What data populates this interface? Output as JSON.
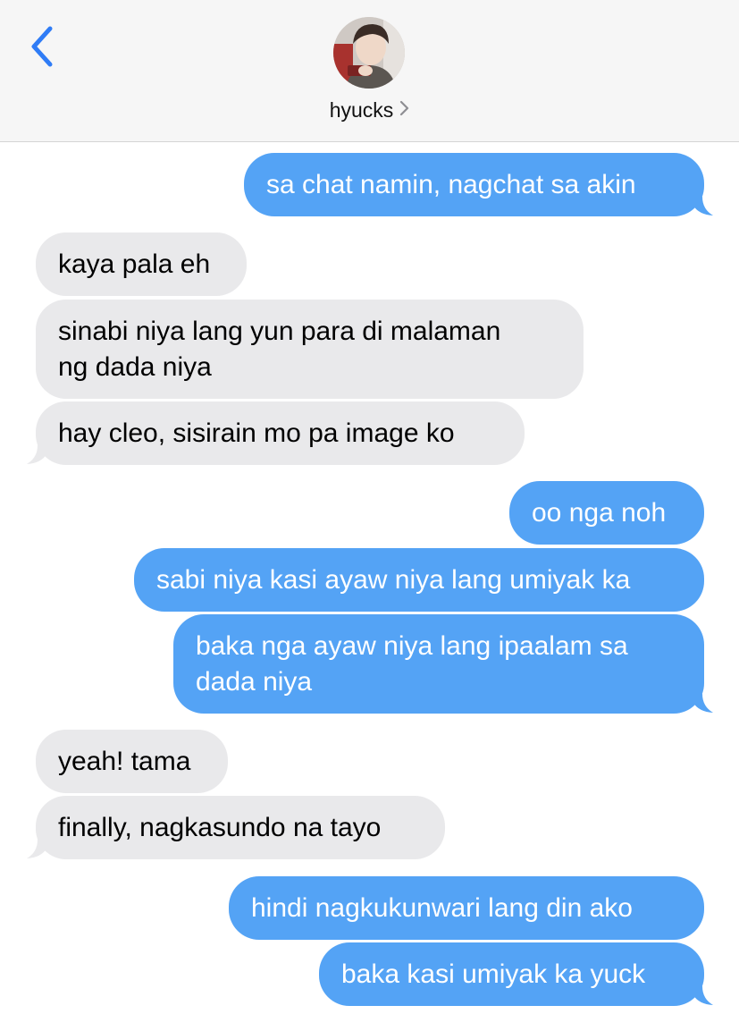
{
  "header": {
    "contact_name": "hyucks",
    "back_icon": "chevron-left-icon",
    "name_chevron_icon": "chevron-right-icon",
    "accent_color": "#2f7cf6"
  },
  "colors": {
    "incoming_bubble": "#e9e9eb",
    "outgoing_bubble": "#54a3f5",
    "header_background": "#f6f6f6"
  },
  "messages": [
    {
      "direction": "outgoing",
      "text": "sa chat namin, nagchat sa akin"
    },
    {
      "direction": "incoming",
      "text": "kaya pala eh"
    },
    {
      "direction": "incoming",
      "lines": [
        "sinabi niya lang yun para di malaman",
        "ng dada niya"
      ]
    },
    {
      "direction": "incoming",
      "text": "hay cleo, sisirain mo pa image ko"
    },
    {
      "direction": "outgoing",
      "text": "oo nga noh"
    },
    {
      "direction": "outgoing",
      "text": "sabi niya kasi ayaw niya lang umiyak ka"
    },
    {
      "direction": "outgoing",
      "lines": [
        "baka nga ayaw niya lang ipaalam sa",
        "dada niya"
      ]
    },
    {
      "direction": "incoming",
      "text": "yeah! tama"
    },
    {
      "direction": "incoming",
      "text": "finally, nagkasundo na tayo"
    },
    {
      "direction": "outgoing",
      "text": "hindi nagkukunwari lang din ako"
    },
    {
      "direction": "outgoing",
      "text": "baka kasi umiyak ka yuck"
    }
  ]
}
